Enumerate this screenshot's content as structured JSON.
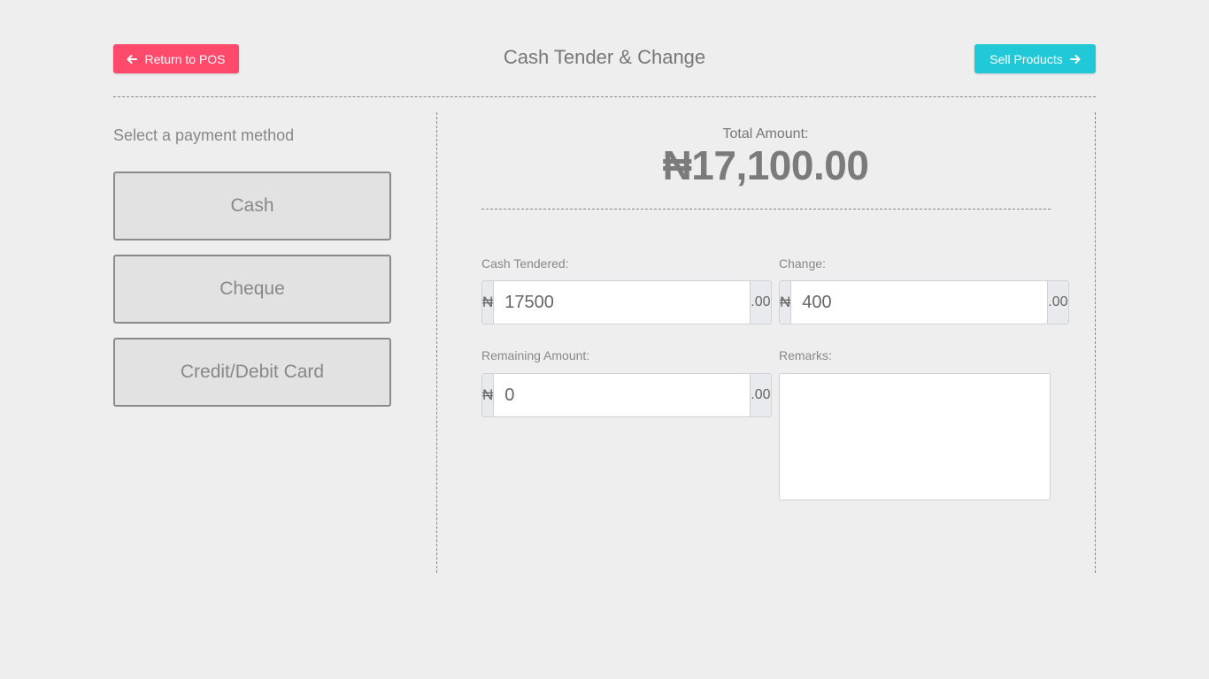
{
  "header": {
    "title": "Cash Tender & Change",
    "return_button": {
      "label": "Return to POS",
      "icon": "arrow-left-icon",
      "color": "#ff4a6c"
    },
    "sell_button": {
      "label": "Sell Products",
      "icon": "arrow-right-icon",
      "color": "#21c9d8"
    }
  },
  "payment_methods": {
    "heading": "Select a payment method",
    "options": [
      {
        "label": "Cash"
      },
      {
        "label": "Cheque"
      },
      {
        "label": "Credit/Debit Card"
      }
    ]
  },
  "summary": {
    "total_label": "Total Amount:",
    "total_value": "₦17,100.00"
  },
  "fields": {
    "currency_symbol": "₦",
    "decimal_suffix": ".00",
    "cash_tendered": {
      "label": "Cash Tendered:",
      "value": "17500"
    },
    "change": {
      "label": "Change:",
      "value": "400"
    },
    "remaining_amount": {
      "label": "Remaining Amount:",
      "value": "0"
    },
    "remarks": {
      "label": "Remarks:",
      "value": ""
    }
  }
}
